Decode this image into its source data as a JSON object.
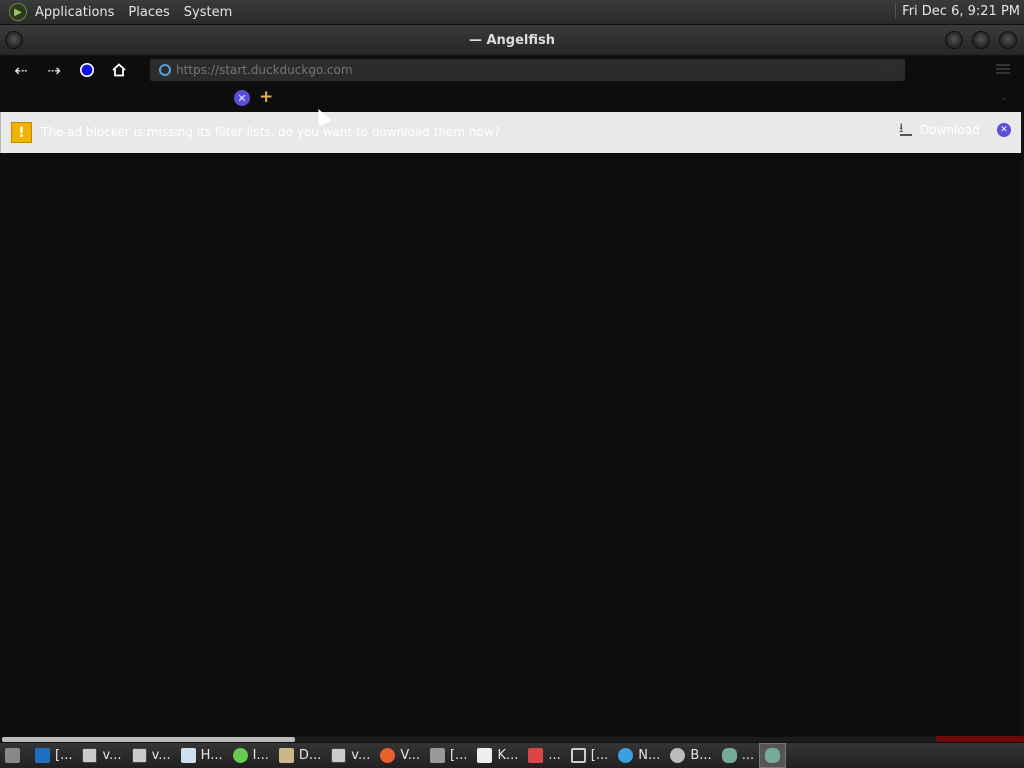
{
  "panel": {
    "menus": [
      "Applications",
      "Places",
      "System"
    ],
    "clock": "Fri Dec 6,  9:21 PM"
  },
  "window": {
    "title": "— Angelfish"
  },
  "toolbar": {
    "url_placeholder": "https://start.duckduckgo.com"
  },
  "infobar": {
    "message": "The ad blocker is missing its filter lists, do you want to download them now?",
    "download_label": "Download"
  },
  "taskbar": {
    "items": [
      "[...",
      "v...",
      "v...",
      "H...",
      "I...",
      "D...",
      "v...",
      "V...",
      "[...",
      "K...",
      "...",
      "[...",
      "N...",
      "B...",
      "..."
    ]
  },
  "colors": {
    "accent": "#5b4ed6",
    "warning": "#f0b400"
  }
}
